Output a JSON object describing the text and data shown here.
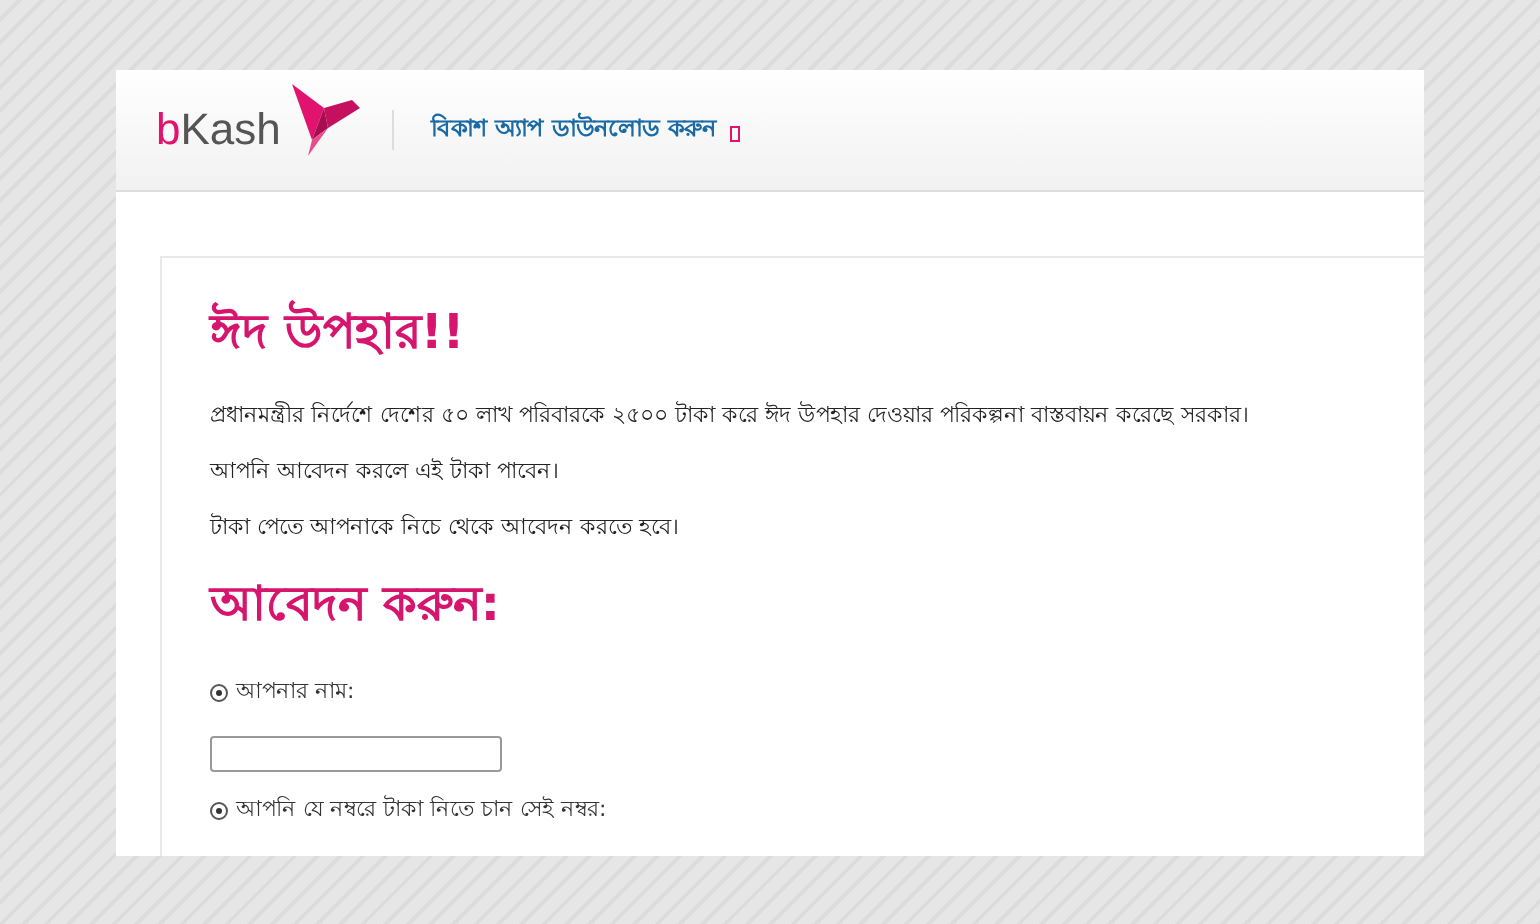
{
  "header": {
    "logo": "bKash",
    "link": "বিকাশ অ্যাপ ডাউনলোড করুন"
  },
  "content": {
    "title": "ঈদ উপহার!!",
    "paragraphs": [
      "প্রধানমন্ত্রীর নির্দেশে দেশের ৫০ লাখ পরিবারকে ২৫০০ টাকা করে ঈদ উপহার দেওয়ার পরিকল্পনা বাস্তবায়ন করেছে সরকার।",
      "আপনি আবেদন করলে এই টাকা পাবেন।",
      "টাকা পেতে আপনাকে নিচে থেকে আবেদন করতে হবে।"
    ],
    "form_title": "আবেদন করুন:",
    "fields": [
      {
        "kind": "text",
        "label": "আপনার নাম:",
        "selected": true
      },
      {
        "kind": "label",
        "label": "আপনি যে নম্বরে টাকা নিতে চান সেই নম্বর:",
        "selected": true
      }
    ]
  }
}
